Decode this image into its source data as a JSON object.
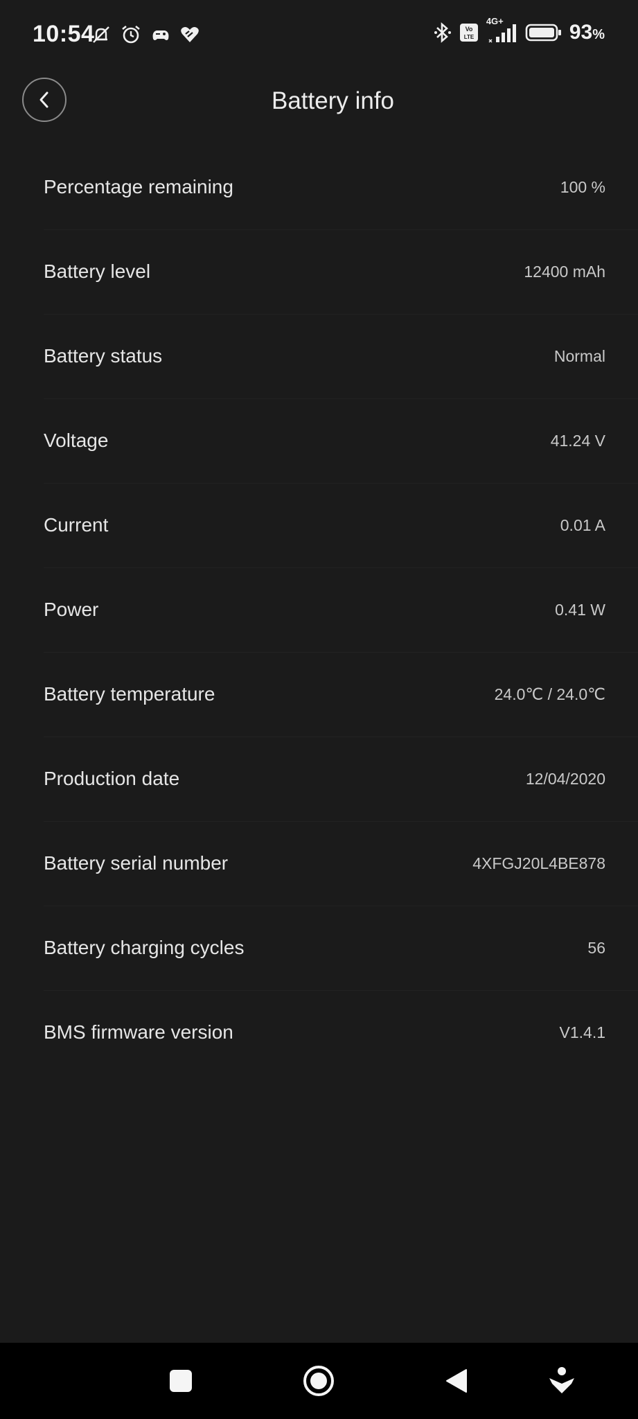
{
  "status_bar": {
    "time": "10:54",
    "battery_percent": "93",
    "battery_unit": "%",
    "network_label": "4G+",
    "icons": [
      "mute-icon",
      "alarm-icon",
      "game-icon",
      "heart-icon",
      "bluetooth-icon",
      "volte-icon",
      "signal-icon",
      "battery-icon"
    ]
  },
  "header": {
    "title": "Battery info",
    "back_icon": "chevron-left-icon"
  },
  "battery_info": [
    {
      "label": "Percentage remaining",
      "value": "100 %"
    },
    {
      "label": "Battery level",
      "value": "12400 mAh"
    },
    {
      "label": "Battery status",
      "value": "Normal"
    },
    {
      "label": "Voltage",
      "value": "41.24 V"
    },
    {
      "label": "Current",
      "value": "0.01 A"
    },
    {
      "label": "Power",
      "value": "0.41 W"
    },
    {
      "label": "Battery temperature",
      "value": "24.0℃ / 24.0℃"
    },
    {
      "label": "Production date",
      "value": "12/04/2020"
    },
    {
      "label": "Battery serial number",
      "value": "4XFGJ20L4BE878"
    },
    {
      "label": "Battery charging cycles",
      "value": "56"
    },
    {
      "label": "BMS firmware version",
      "value": "V1.4.1"
    }
  ],
  "nav_bar": {
    "icons": [
      "recents-icon",
      "home-icon",
      "back-icon",
      "assistant-icon"
    ]
  },
  "colors": {
    "background": "#1b1b1b",
    "text_primary": "#e6e6e6",
    "text_secondary": "#c9c9c9",
    "nav_background": "#000000"
  }
}
